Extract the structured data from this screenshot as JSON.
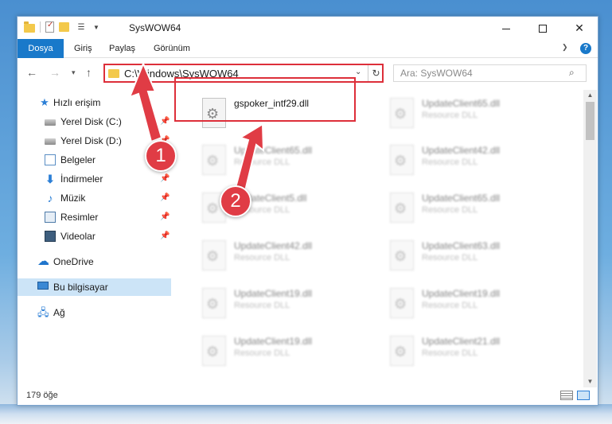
{
  "window": {
    "title": "SysWOW64",
    "minimize": "–",
    "close": "✕"
  },
  "ribbon": {
    "tabs": [
      "Dosya",
      "Giriş",
      "Paylaş",
      "Görünüm"
    ],
    "help": "?"
  },
  "address": {
    "path": "C:\\Windows\\SysWOW64",
    "search_placeholder": "Ara: SysWOW64"
  },
  "sidebar": {
    "items": [
      {
        "label": "Hızlı erişim",
        "icon": "star-icon"
      },
      {
        "label": "Yerel Disk (C:)",
        "icon": "drive-icon",
        "pinned": true
      },
      {
        "label": "Yerel Disk (D:)",
        "icon": "drive-icon",
        "pinned": true
      },
      {
        "label": "Belgeler",
        "icon": "documents-icon",
        "pinned": true
      },
      {
        "label": "İndirmeler",
        "icon": "downloads-icon",
        "pinned": true
      },
      {
        "label": "Müzik",
        "icon": "music-icon",
        "pinned": true
      },
      {
        "label": "Resimler",
        "icon": "pictures-icon",
        "pinned": true
      },
      {
        "label": "Videolar",
        "icon": "videos-icon",
        "pinned": true
      },
      {
        "label": "OneDrive",
        "icon": "cloud-icon"
      },
      {
        "label": "Bu bilgisayar",
        "icon": "computer-icon",
        "selected": true
      },
      {
        "label": "Ağ",
        "icon": "network-icon"
      }
    ]
  },
  "files": {
    "highlighted": {
      "name": "gspoker_intf29.dll"
    },
    "blurred": [
      {
        "name": "UpdateClient65.dll",
        "type": "Resource DLL"
      },
      {
        "name": "UpdateClient65.dll",
        "type": "Resource DLL"
      },
      {
        "name": "UpdateClient42.dll",
        "type": "Resource DLL"
      },
      {
        "name": "UpdateClient5.dll",
        "type": "Resource DLL"
      },
      {
        "name": "UpdateClient65.dll",
        "type": "Resource DLL"
      },
      {
        "name": "UpdateClient42.dll",
        "type": "Resource DLL"
      },
      {
        "name": "UpdateClient63.dll",
        "type": "Resource DLL"
      },
      {
        "name": "UpdateClient19.dll",
        "type": "Resource DLL"
      },
      {
        "name": "UpdateClient19.dll",
        "type": "Resource DLL"
      },
      {
        "name": "UpdateClient19.dll",
        "type": "Resource DLL"
      },
      {
        "name": "UpdateClient21.dll",
        "type": "Resource DLL"
      }
    ]
  },
  "status": {
    "item_count": "179 öğe"
  },
  "annotations": {
    "step1": "1",
    "step2": "2",
    "color": "#e03c45"
  }
}
